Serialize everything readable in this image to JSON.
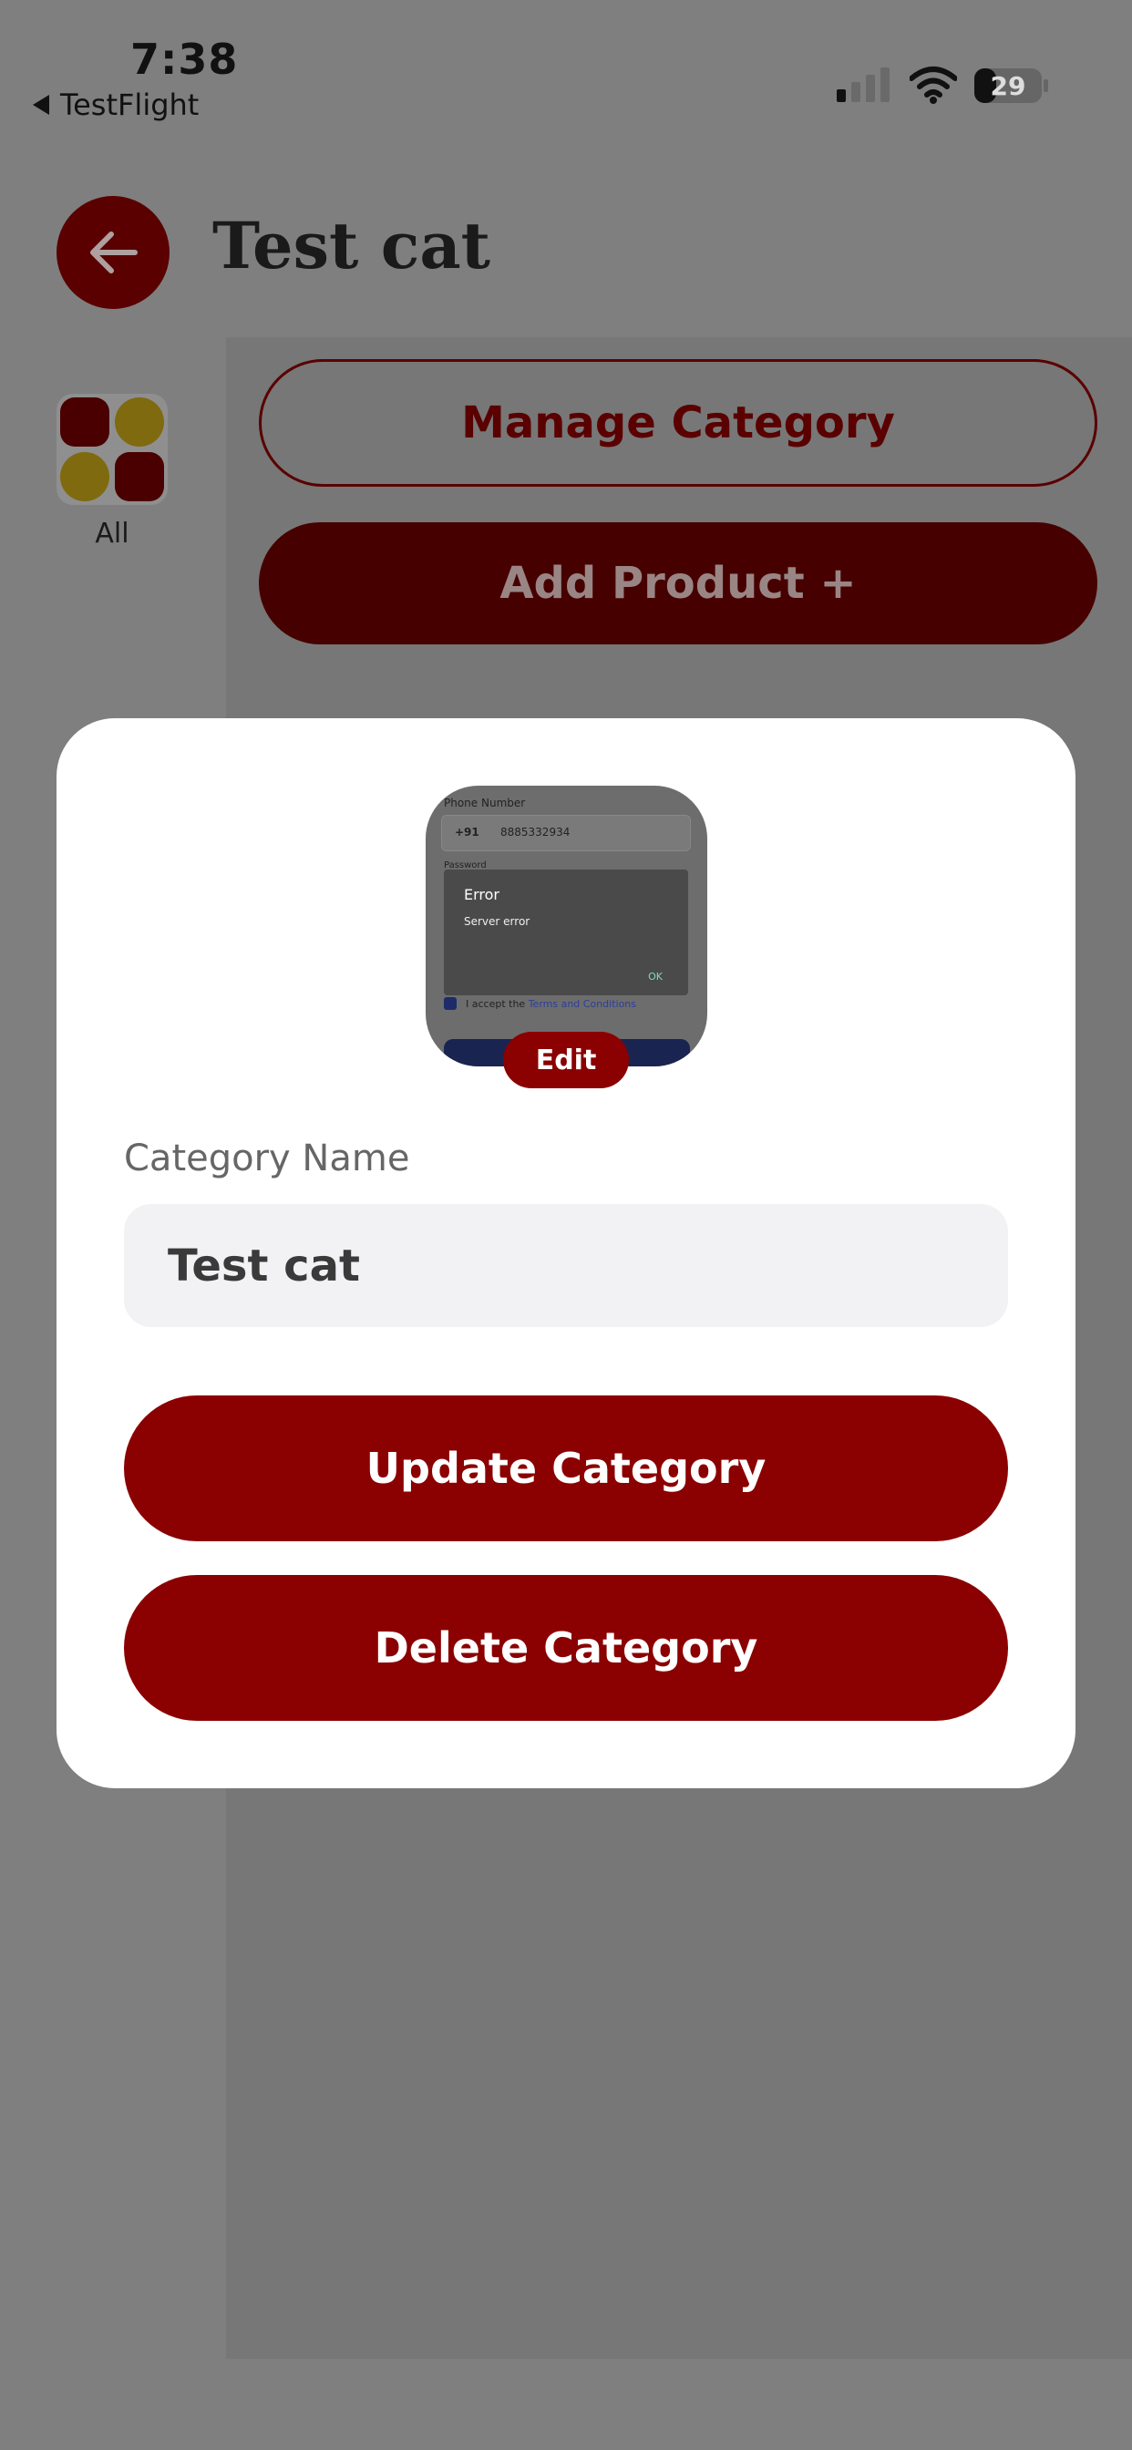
{
  "status_bar": {
    "time": "7:38",
    "back_app": "TestFlight",
    "battery_level": "29"
  },
  "header": {
    "title": "Test cat"
  },
  "sidebar": {
    "all_label": "All"
  },
  "content": {
    "manage_category_label": "Manage Category",
    "add_product_label": "Add Product +"
  },
  "modal": {
    "image_preview": {
      "phone_label": "Phone Number",
      "country_code": "+91",
      "phone_value": "8885332934",
      "password_label": "Password",
      "error_title": "Error",
      "error_message": "Server error",
      "ok_label": "OK",
      "accept_prefix": "I accept the",
      "accept_link": "Terms and Conditions"
    },
    "edit_label": "Edit",
    "field_label": "Category Name",
    "field_value": "Test cat",
    "update_label": "Update Category",
    "delete_label": "Delete Category"
  },
  "colors": {
    "brand_red": "#8b0000",
    "overlay": "#7f7f7f",
    "modal_bg": "#ffffff",
    "input_bg": "#f2f2f4",
    "icon_yellow": "#c9a400"
  }
}
